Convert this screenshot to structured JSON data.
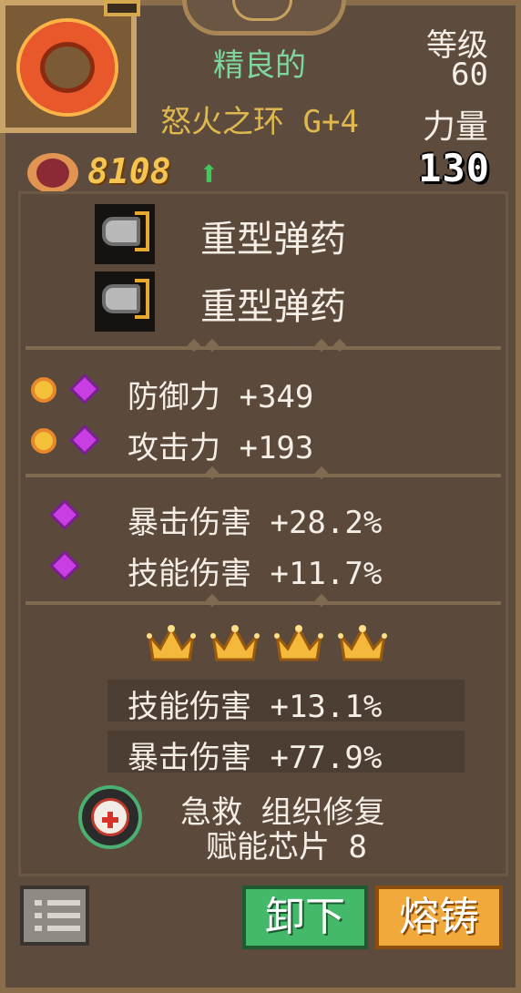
{
  "colors": {
    "rarity": "#7ed69c",
    "item_name": "#e0b84e",
    "power": "#f5c451",
    "arrow_up": "#3ecb5b",
    "unequip": "#45b96a",
    "reforge": "#f2a93b"
  },
  "header": {
    "rarity": "精良的",
    "item_name": "怒火之环 G+4",
    "level_label": "等级",
    "level_value": "60",
    "stat_label": "力量",
    "stat_value": "130",
    "power_value": "8108",
    "power_trend_icon": "arrow-up-icon"
  },
  "ammo": [
    {
      "label": "重型弹药",
      "icon": "heavy-ammo-icon"
    },
    {
      "label": "重型弹药",
      "icon": "heavy-ammo-icon"
    }
  ],
  "base_stats": [
    {
      "text": "防御力 +349"
    },
    {
      "text": "攻击力 +193"
    }
  ],
  "extra_stats": [
    {
      "text": "暴击伤害 +28.2%"
    },
    {
      "text": "技能伤害 +11.7%"
    }
  ],
  "crown_count": 4,
  "crown_bonuses": [
    {
      "text": "技能伤害 +13.1%"
    },
    {
      "text": "暴击伤害 +77.9%"
    }
  ],
  "chip": {
    "name": "急救 组织修复",
    "subtitle": "赋能芯片 8",
    "icon": "first-aid-chip-icon"
  },
  "buttons": {
    "menu_icon": "list-icon",
    "unequip": "卸下",
    "reforge": "熔铸"
  }
}
